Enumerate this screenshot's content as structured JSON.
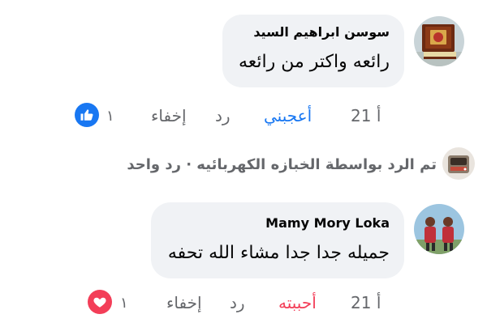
{
  "colors": {
    "like_blue": "#1877f2",
    "love_red": "#f33e58",
    "bubble_bg": "#f0f2f5",
    "meta_gray": "#65676b",
    "text_dark": "#050505"
  },
  "comments": [
    {
      "author": "سوسن ابراهيم السيد",
      "text": "رائعه واكتر من رائعه",
      "time": "21 أ",
      "reaction_link": "أعجبني",
      "reply": "رد",
      "hide": "إخفاء",
      "reaction_count": "١",
      "reaction_icon": "thumbs-up-icon"
    },
    {
      "author": "Mamy Mory Loka",
      "text": "جميله جدا جدا مشاء الله تحفه",
      "time": "21 أ",
      "reaction_link": "أحببته",
      "reply": "رد",
      "hide": "إخفاء",
      "reaction_count": "١",
      "reaction_icon": "heart-icon"
    }
  ],
  "replies_summary": {
    "text": "تم الرد بواسطة الخبازه الكهربائيه · رد واحد"
  }
}
